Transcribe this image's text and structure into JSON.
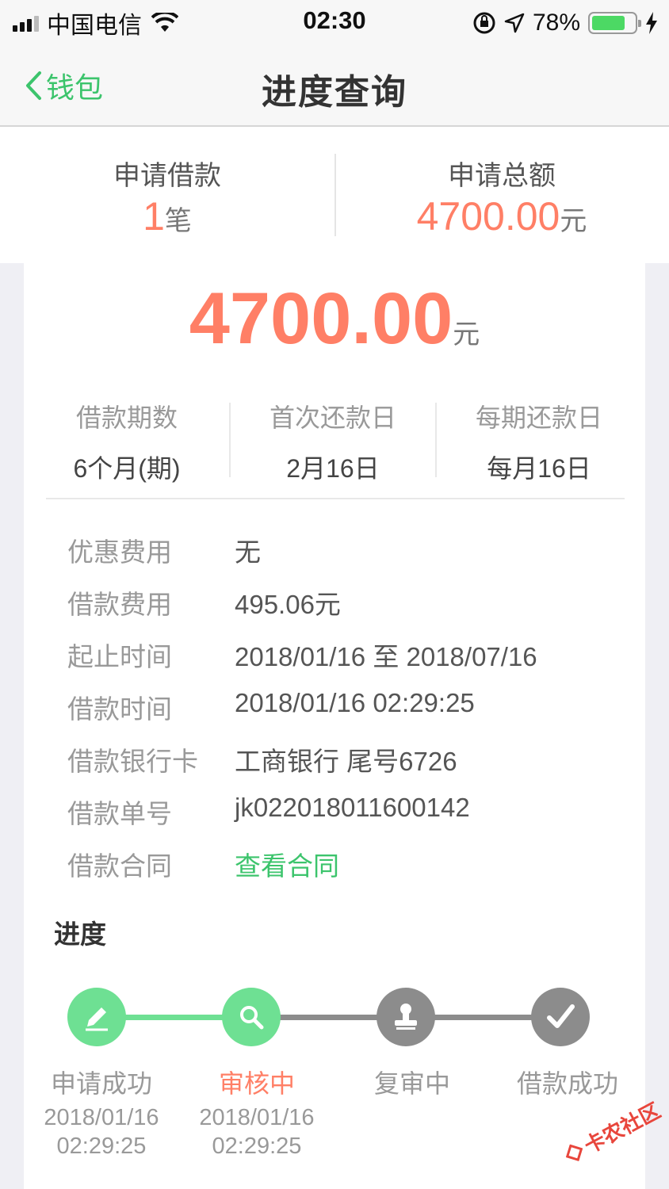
{
  "status_bar": {
    "carrier": "中国电信",
    "time": "02:30",
    "battery_percent": "78%",
    "battery_level": 0.78
  },
  "nav": {
    "back_label": "钱包",
    "title": "进度查询"
  },
  "summary": {
    "count_label": "申请借款",
    "count_value": "1",
    "count_unit": "笔",
    "total_label": "申请总额",
    "total_value": "4700.00",
    "total_unit": "元"
  },
  "loan": {
    "amount": "4700.00",
    "amount_unit": "元",
    "terms": [
      {
        "label": "借款期数",
        "value": "6个月(期)"
      },
      {
        "label": "首次还款日",
        "value": "2月16日"
      },
      {
        "label": "每期还款日",
        "value": "每月16日"
      }
    ],
    "details": [
      {
        "key": "优惠费用",
        "value": "无"
      },
      {
        "key": "借款费用",
        "value": "495.06元"
      },
      {
        "key": "起止时间",
        "value": "2018/01/16 至 2018/07/16"
      },
      {
        "key": "借款时间",
        "value": "2018/01/16 02:29:25"
      },
      {
        "key": "借款银行卡",
        "value": "工商银行 尾号6726"
      },
      {
        "key": "借款单号",
        "value": "jk022018011600142"
      },
      {
        "key": "借款合同",
        "value": "查看合同"
      }
    ]
  },
  "progress": {
    "title": "进度",
    "steps": [
      {
        "label": "申请成功",
        "date": "2018/01/16",
        "time": "02:29:25",
        "icon": "pencil-icon",
        "state": "done"
      },
      {
        "label": "审核中",
        "date": "2018/01/16",
        "time": "02:29:25",
        "icon": "search-icon",
        "state": "current"
      },
      {
        "label": "复审中",
        "date": "",
        "time": "",
        "icon": "stamp-icon",
        "state": "pending"
      },
      {
        "label": "借款成功",
        "date": "",
        "time": "",
        "icon": "check-icon",
        "state": "pending"
      }
    ],
    "colors": {
      "done": "#6ee093",
      "current": "#ff7f66",
      "pending": "#8c8c8c"
    }
  },
  "watermark": "卡农社区"
}
